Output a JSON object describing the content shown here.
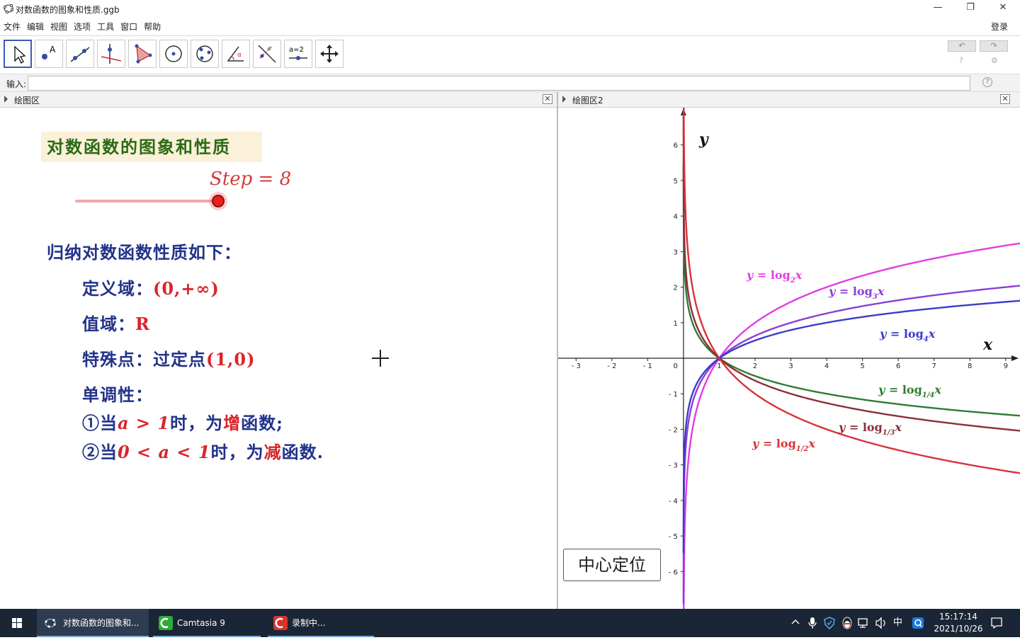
{
  "window": {
    "title": "对数函数的图象和性质.ggb",
    "min": "—",
    "restore": "❐",
    "close": "✕"
  },
  "menu": {
    "items": [
      "文件",
      "编辑",
      "视图",
      "选项",
      "工具",
      "窗口",
      "帮助"
    ],
    "login": "登录"
  },
  "tools": [
    "move",
    "point",
    "line",
    "perpendicular",
    "polygon",
    "circle",
    "conic",
    "angle",
    "reflect",
    "slider",
    "move-graphics"
  ],
  "tool_labels": {
    "point_text": "A",
    "angle_text": "α",
    "slider_text": "a=2"
  },
  "undo": {
    "undo": "↶",
    "redo": "↷",
    "help": "?",
    "settings": "⚙"
  },
  "input": {
    "label": "输入:",
    "value": "",
    "help": "?"
  },
  "panel1": {
    "name": "绘图区",
    "close": "✕"
  },
  "panel2": {
    "name": "绘图区2",
    "close": "✕"
  },
  "content": {
    "title": "对数函数的图象和性质",
    "step_label": "Step = 8",
    "slider_value": 8,
    "heading": "归纳对数函数性质如下：",
    "domain_label": "定义域：",
    "domain_value": "(0,+∞)",
    "range_label": "值域：",
    "range_value": "R",
    "special_label": "特殊点：过定点",
    "special_value": "(1,0)",
    "mono_label": "单调性：",
    "mono1_prefix": "①当",
    "mono1_cond": "a > 1",
    "mono1_mid": "时，为",
    "mono1_key": "增",
    "mono1_tail": "函数;",
    "mono2_prefix": "②当",
    "mono2_cond": "0 < a < 1",
    "mono2_mid": "时，为",
    "mono2_key": "减",
    "mono2_tail": "函数."
  },
  "graph": {
    "axis_x": "x",
    "axis_y": "y",
    "xlim": [
      -3.5,
      9.4
    ],
    "ylim": [
      -7.05,
      7.05
    ],
    "x_ticks": [
      -3,
      -2,
      -1,
      1,
      2,
      3,
      4,
      5,
      6,
      7,
      8,
      9
    ],
    "y_ticks": [
      -6,
      -5,
      -4,
      -3,
      -2,
      -1,
      1,
      2,
      3,
      4,
      5,
      6
    ],
    "origin_label": "0",
    "curves": [
      {
        "base": 2,
        "color": "#e23de3",
        "label": {
          "y": "y = ",
          "log": "log",
          "sub": "2",
          "x": "x"
        }
      },
      {
        "base": 3,
        "color": "#8a3fd6",
        "label": {
          "y": "y = ",
          "log": "log",
          "sub": "3",
          "x": "x"
        }
      },
      {
        "base": 4,
        "color": "#3c3ccc",
        "label": {
          "y": "y = ",
          "log": "log",
          "sub": "4",
          "x": "x"
        }
      },
      {
        "base": 0.25,
        "color": "#2e7d32",
        "label": {
          "y": "y = ",
          "log": "log",
          "sub": "1/4",
          "x": "x"
        }
      },
      {
        "base": 0.3333,
        "color": "#8b2f3a",
        "label": {
          "y": "y = ",
          "log": "log",
          "sub": "1/3",
          "x": "x"
        }
      },
      {
        "base": 0.5,
        "color": "#d9323a",
        "label": {
          "y": "y = ",
          "log": "log",
          "sub": "1/2",
          "x": "x"
        }
      }
    ],
    "center_button": "中心定位"
  },
  "taskbar": {
    "items": [
      "对数函数的图象和...",
      "Camtasia 9",
      "录制中..."
    ],
    "tray_ime": "中",
    "time": "15:17:14",
    "date": "2021/10/26"
  }
}
